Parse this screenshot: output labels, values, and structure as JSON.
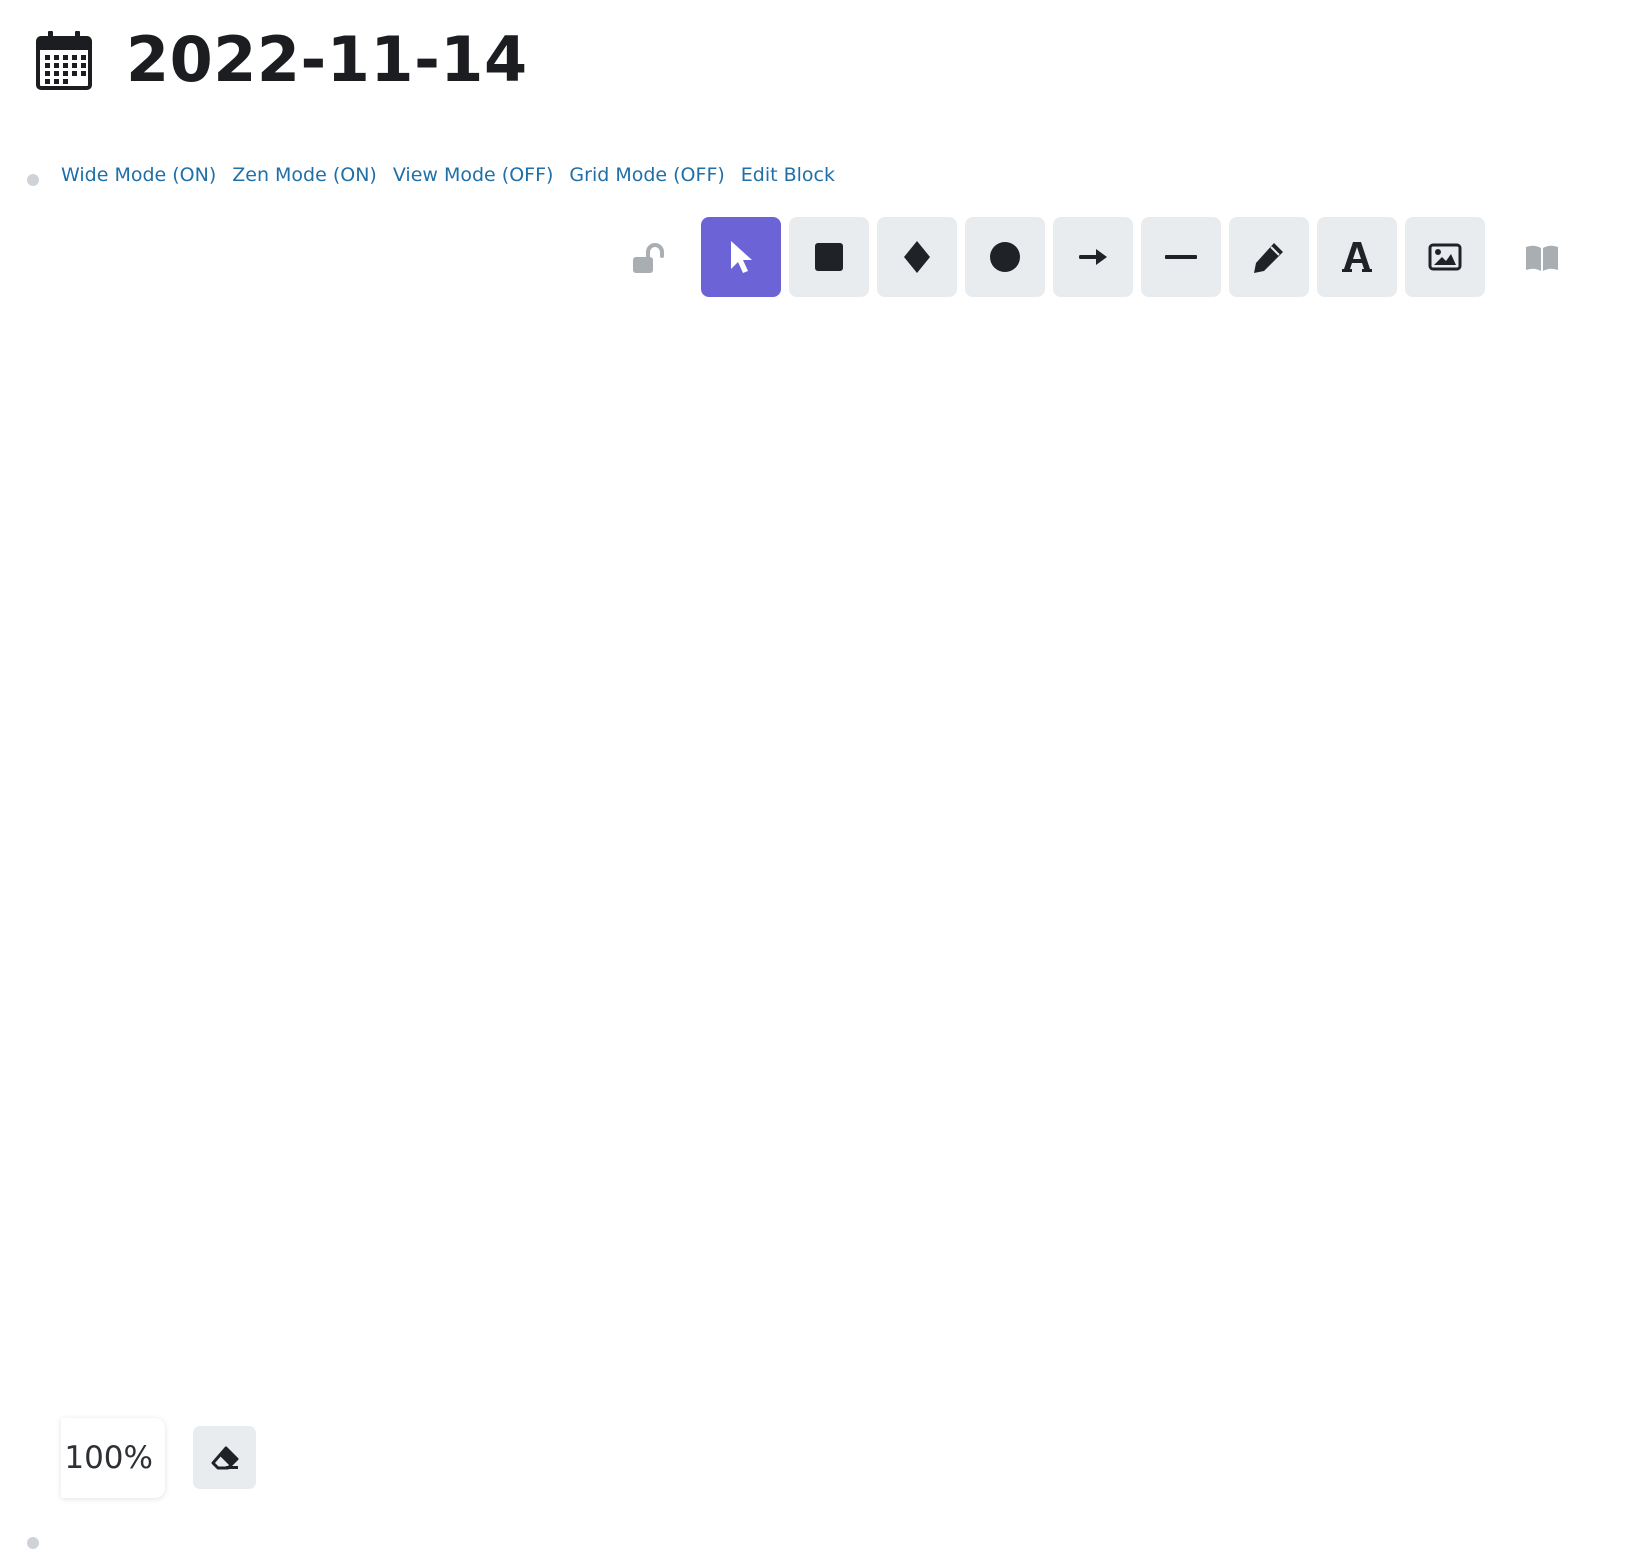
{
  "header": {
    "title": "2022-11-14",
    "icon": "calendar-icon"
  },
  "links": [
    {
      "label": "Wide Mode (ON)"
    },
    {
      "label": "Zen Mode (ON)"
    },
    {
      "label": "View Mode (OFF)"
    },
    {
      "label": "Grid Mode (OFF)"
    },
    {
      "label": "Edit Block"
    }
  ],
  "toolbar": {
    "lock_icon": "unlock-icon",
    "active_tool": "selection",
    "accent_color": "#6b63d6",
    "tools": [
      {
        "id": "selection",
        "icon": "pointer-icon"
      },
      {
        "id": "rectangle",
        "icon": "square-icon"
      },
      {
        "id": "diamond",
        "icon": "diamond-icon"
      },
      {
        "id": "ellipse",
        "icon": "circle-icon"
      },
      {
        "id": "arrow",
        "icon": "arrow-icon"
      },
      {
        "id": "line",
        "icon": "line-icon"
      },
      {
        "id": "draw",
        "icon": "pencil-icon"
      },
      {
        "id": "text",
        "icon": "text-icon"
      },
      {
        "id": "image",
        "icon": "image-icon"
      }
    ],
    "library_icon": "library-icon"
  },
  "footer": {
    "zoom": "100%",
    "eraser_icon": "eraser-icon"
  }
}
